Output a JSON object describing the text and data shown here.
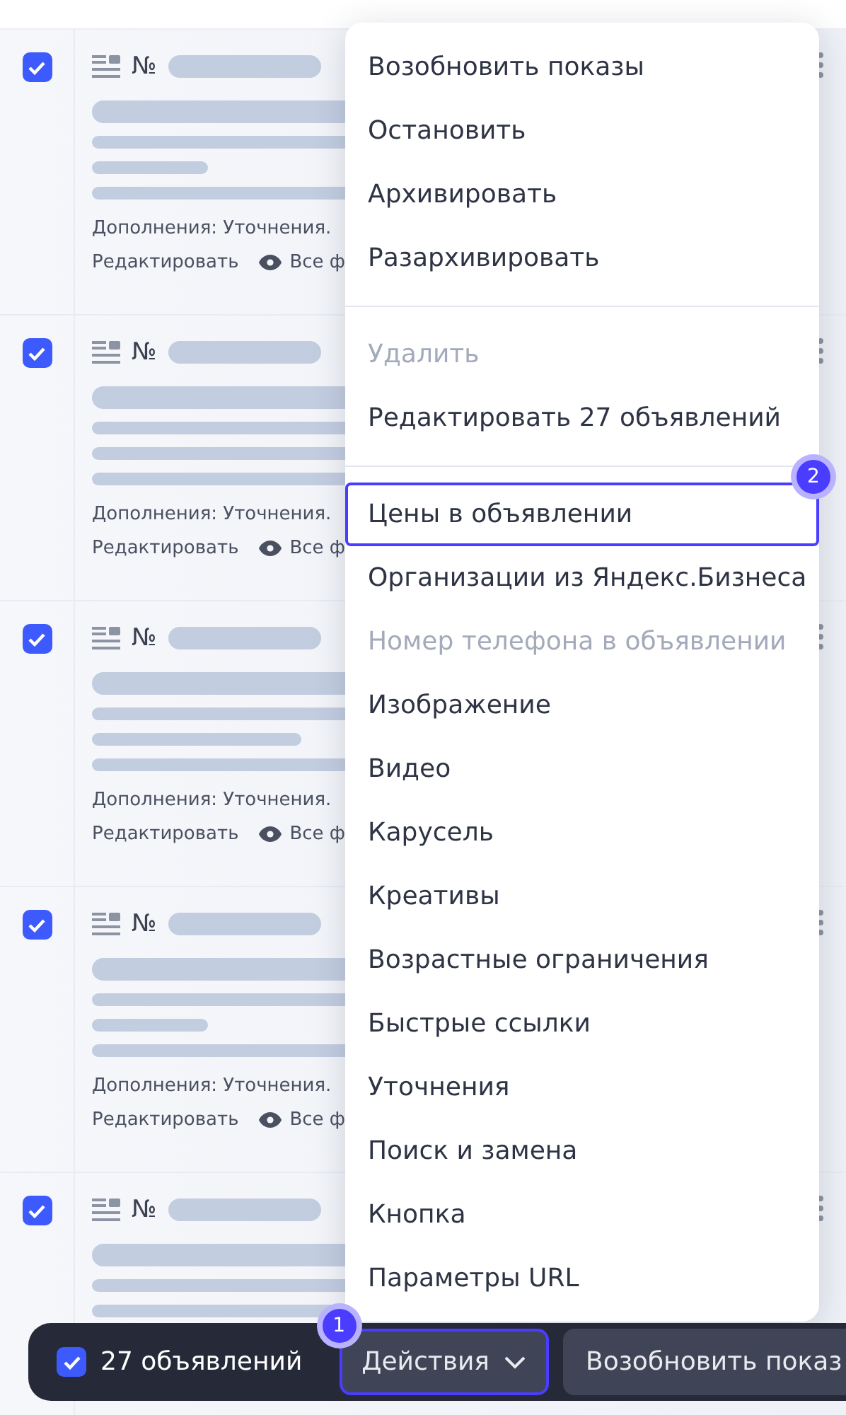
{
  "ads": [
    {
      "checked": true,
      "number_label": "№",
      "extras": "Дополнения: Уточнения.",
      "edit_link": "Редактировать",
      "formats_link": "Все ф"
    },
    {
      "checked": true,
      "number_label": "№",
      "extras": "Дополнения: Уточнения.",
      "edit_link": "Редактировать",
      "formats_link": "Все ф"
    },
    {
      "checked": true,
      "number_label": "№",
      "extras": "Дополнения: Уточнения.",
      "edit_link": "Редактировать",
      "formats_link": "Все ф"
    },
    {
      "checked": true,
      "number_label": "№",
      "extras": "Дополнения: Уточнения.",
      "edit_link": "Редактировать",
      "formats_link": "Все ф"
    },
    {
      "checked": true,
      "number_label": "№"
    }
  ],
  "menu": {
    "groups": [
      [
        {
          "label": "Возобновить показы",
          "disabled": false,
          "selected": false
        },
        {
          "label": "Остановить",
          "disabled": false,
          "selected": false
        },
        {
          "label": "Архивировать",
          "disabled": false,
          "selected": false
        },
        {
          "label": "Разархивировать",
          "disabled": false,
          "selected": false
        }
      ],
      [
        {
          "label": "Удалить",
          "disabled": true,
          "selected": false
        },
        {
          "label": "Редактировать 27 объявлений",
          "disabled": false,
          "selected": false
        }
      ],
      [
        {
          "label": "Цены в объявлении",
          "disabled": false,
          "selected": true,
          "step_badge": "2"
        },
        {
          "label": "Организации из Яндекс.Бизнеса",
          "disabled": false,
          "selected": false
        },
        {
          "label": "Номер телефона в объявлении",
          "disabled": true,
          "selected": false
        },
        {
          "label": "Изображение",
          "disabled": false,
          "selected": false
        },
        {
          "label": "Видео",
          "disabled": false,
          "selected": false
        },
        {
          "label": "Карусель",
          "disabled": false,
          "selected": false
        },
        {
          "label": "Креативы",
          "disabled": false,
          "selected": false
        },
        {
          "label": "Возрастные ограничения",
          "disabled": false,
          "selected": false
        },
        {
          "label": "Быстрые ссылки",
          "disabled": false,
          "selected": false
        },
        {
          "label": "Уточнения",
          "disabled": false,
          "selected": false
        },
        {
          "label": "Поиск и замена",
          "disabled": false,
          "selected": false
        },
        {
          "label": "Кнопка",
          "disabled": false,
          "selected": false
        },
        {
          "label": "Параметры URL",
          "disabled": false,
          "selected": false
        }
      ]
    ]
  },
  "action_bar": {
    "checked": true,
    "count": "27 объявлений",
    "actions_button": {
      "label": "Действия",
      "selected": true,
      "step_badge": "1"
    },
    "next_button": "Возобновить показ"
  }
}
